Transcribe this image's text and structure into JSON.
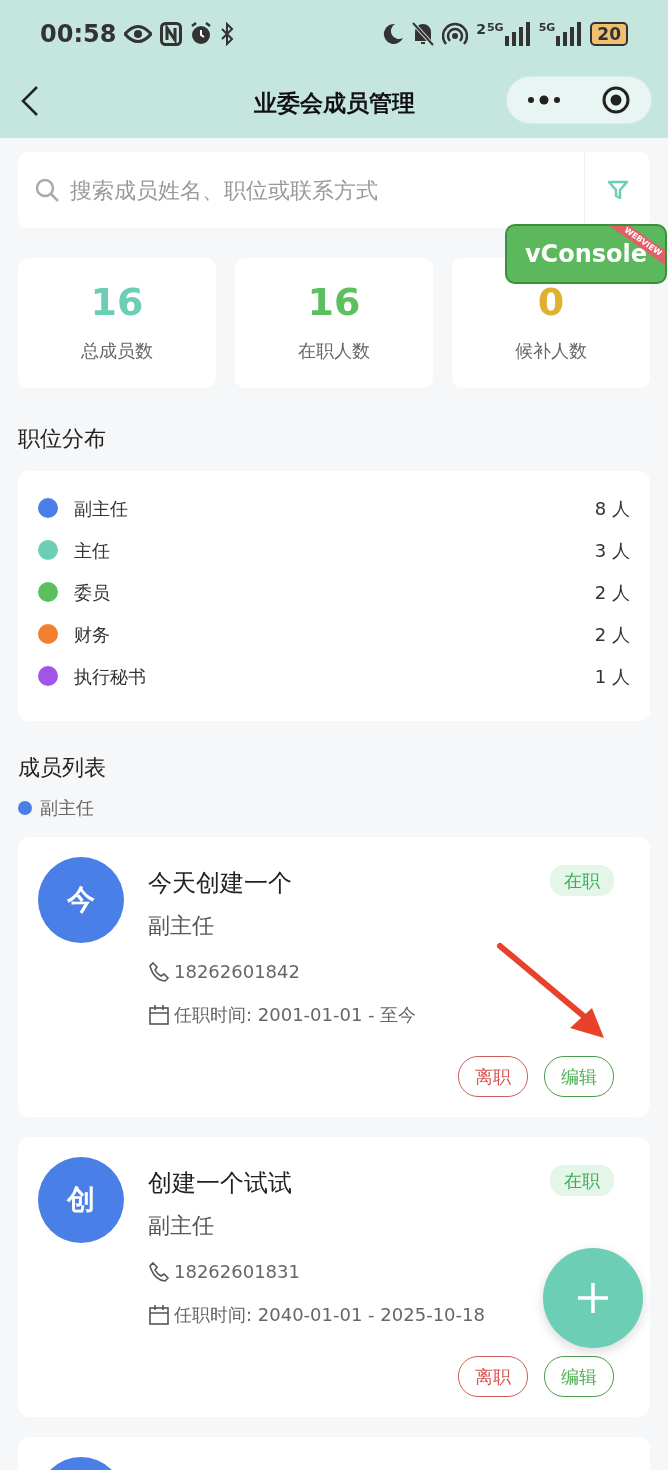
{
  "status_bar": {
    "time": "00:58",
    "sim1_label": "2",
    "sim1_network": "5G",
    "sim2_network": "5G",
    "battery": "20"
  },
  "nav": {
    "title": "业委会成员管理"
  },
  "search": {
    "placeholder": "搜索成员姓名、职位或联系方式"
  },
  "debug_button": {
    "label": "vConsole",
    "ribbon": "WEBVIEW"
  },
  "stats": [
    {
      "value": "16",
      "label": "总成员数",
      "color": "#6ccfb5"
    },
    {
      "value": "16",
      "label": "在职人数",
      "color": "#5cbf60"
    },
    {
      "value": "0",
      "label": "候补人数",
      "color": "#e0b030"
    }
  ],
  "distribution": {
    "title": "职位分布",
    "items": [
      {
        "name": "副主任",
        "count": "8 人",
        "color": "#4a7fe8"
      },
      {
        "name": "主任",
        "count": "3 人",
        "color": "#6ccfb5"
      },
      {
        "name": "委员",
        "count": "2 人",
        "color": "#5cbf60"
      },
      {
        "name": "财务",
        "count": "2 人",
        "color": "#f08030"
      },
      {
        "name": "执行秘书",
        "count": "1 人",
        "color": "#a055e8"
      }
    ]
  },
  "members": {
    "title": "成员列表",
    "group": {
      "name": "副主任",
      "color": "#4a7fe8"
    },
    "items": [
      {
        "avatar": "今",
        "name": "今天创建一个",
        "role": "副主任",
        "phone": "18262601842",
        "tenure": "任职时间: 2001-01-01 - 至今",
        "status": "在职",
        "actions": [
          "离职",
          "编辑"
        ]
      },
      {
        "avatar": "创",
        "name": "创建一个试试",
        "role": "副主任",
        "phone": "18262601831",
        "tenure": "任职时间: 2040-01-01 - 2025-10-18",
        "status": "在职",
        "actions": [
          "离职",
          "编辑"
        ]
      }
    ]
  }
}
